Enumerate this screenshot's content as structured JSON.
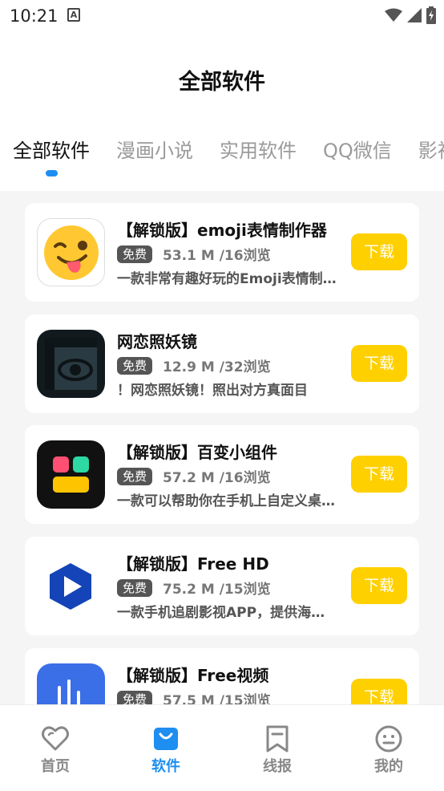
{
  "status_bar": {
    "time": "10:21",
    "notification_icon": "A"
  },
  "header": {
    "title": "全部软件",
    "tabs": [
      {
        "label": "全部软件",
        "active": true
      },
      {
        "label": "漫画小说",
        "active": false
      },
      {
        "label": "实用软件",
        "active": false
      },
      {
        "label": "QQ微信",
        "active": false
      },
      {
        "label": "影视",
        "active": false
      }
    ]
  },
  "apps": [
    {
      "title": "【解锁版】emoji表情制作器",
      "badge": "免费",
      "meta": "53.1 M /16浏览",
      "desc": "一款非常有趣好玩的Emoji表情制作器",
      "button": "下载",
      "icon": "emoji-face-icon"
    },
    {
      "title": "网恋照妖镜",
      "badge": "免费",
      "meta": "12.9 M /32浏览",
      "desc": "！网恋照妖镜！照出对方真面目",
      "button": "下载",
      "icon": "eye-cube-icon"
    },
    {
      "title": "【解锁版】百变小组件",
      "badge": "免费",
      "meta": "57.2 M /16浏览",
      "desc": "一款可以帮助你在手机上自定义桌面的工具",
      "button": "下载",
      "icon": "widget-blocks-icon"
    },
    {
      "title": "【解锁版】Free HD",
      "badge": "免费",
      "meta": "75.2 M /15浏览",
      "desc": "一款手机追剧影视APP，提供海量资源",
      "button": "下载",
      "icon": "play-hexagon-icon"
    },
    {
      "title": "【解锁版】Free视频",
      "badge": "免费",
      "meta": "57.5 M /15浏览",
      "desc": "",
      "button": "下载",
      "icon": "music-note-icon"
    }
  ],
  "bottom_nav": [
    {
      "label": "首页",
      "icon": "heart-icon",
      "active": false
    },
    {
      "label": "软件",
      "icon": "bag-icon",
      "active": true
    },
    {
      "label": "线报",
      "icon": "bookmark-icon",
      "active": false
    },
    {
      "label": "我的",
      "icon": "smiley-icon",
      "active": false
    }
  ],
  "colors": {
    "accent": "#1e8ef0",
    "download": "#ffd000",
    "badge": "#555555"
  }
}
